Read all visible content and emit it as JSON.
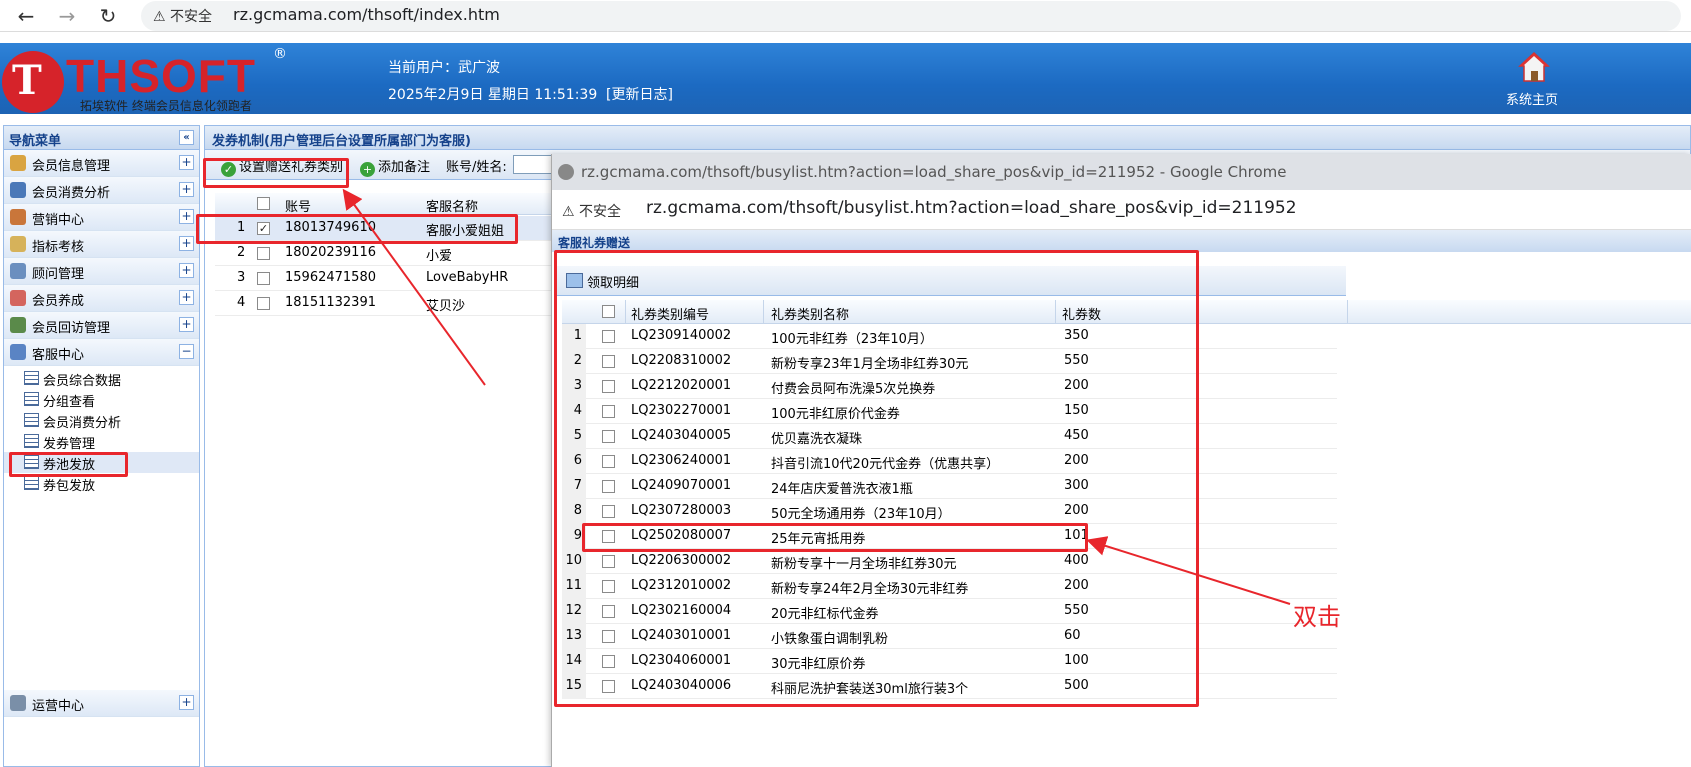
{
  "browser": {
    "back": "←",
    "forward": "→",
    "reload": "↻",
    "insecure_label": "⚠ 不安全",
    "url": "rz.gcmama.com/thsoft/index.htm"
  },
  "header": {
    "logo_text": "THSOFT",
    "logo_mark": "T",
    "logo_reg": "®",
    "logo_sub": "拓埃软件  终端会员信息化领跑者",
    "current_user": "当前用户：武广波",
    "datetime": "2025年2月9日 星期日 11:51:39",
    "changelog": "[更新日志]",
    "home_label": "系统主页"
  },
  "sidebar": {
    "title": "导航菜单",
    "collapse": "«",
    "items": [
      {
        "label": "会员信息管理",
        "toggle": "+",
        "color": "#d9a441"
      },
      {
        "label": "会员消费分析",
        "toggle": "+",
        "color": "#4a78b8"
      },
      {
        "label": "营销中心",
        "toggle": "+",
        "color": "#c9763a"
      },
      {
        "label": "指标考核",
        "toggle": "+",
        "color": "#d6b25a"
      },
      {
        "label": "顾问管理",
        "toggle": "+",
        "color": "#6b8fbf"
      },
      {
        "label": "会员养成",
        "toggle": "+",
        "color": "#d4655e"
      },
      {
        "label": "会员回访管理",
        "toggle": "+",
        "color": "#5a8a4a"
      },
      {
        "label": "客服中心",
        "toggle": "−",
        "color": "#5a84c4"
      }
    ],
    "sub_items": [
      "会员综合数据",
      "分组查看",
      "会员消费分析",
      "发券管理",
      "券池发放",
      "券包发放"
    ],
    "bottom_item": {
      "label": "运营中心",
      "toggle": "+"
    }
  },
  "main": {
    "title": "发券机制(用户管理后台设置所属部门为客服)",
    "toolbar": {
      "set_btn": "设置赠送礼券类别",
      "add_btn": "添加备注",
      "search_label": "账号/姓名:"
    },
    "columns": [
      "账号",
      "客服名称"
    ],
    "rows": [
      {
        "n": "1",
        "account": "18013749610",
        "name": "客服小爱姐姐",
        "checked": "✓"
      },
      {
        "n": "2",
        "account": "18020239116",
        "name": "小爱",
        "checked": ""
      },
      {
        "n": "3",
        "account": "15962471580",
        "name": "LoveBabyHR",
        "checked": ""
      },
      {
        "n": "4",
        "account": "18151132391",
        "name": "艾贝沙",
        "checked": ""
      }
    ]
  },
  "popup": {
    "window_title": "rz.gcmama.com/thsoft/busylist.htm?action=load_share_pos&vip_id=211952 - Google Chrome",
    "insecure_label": "⚠ 不安全",
    "url": "rz.gcmama.com/thsoft/busylist.htm?action=load_share_pos&vip_id=211952",
    "inner_title": "客服礼券赠送",
    "toolbar_btn": "领取明细",
    "columns": [
      "礼券类别编号",
      "礼券类别名称",
      "礼券数"
    ],
    "rows": [
      {
        "n": "1",
        "code": "LQ2309140002",
        "name": "100元非红券（23年10月）",
        "qty": "350"
      },
      {
        "n": "2",
        "code": "LQ2208310002",
        "name": "新粉专享23年1月全场非红券30元",
        "qty": "550"
      },
      {
        "n": "3",
        "code": "LQ2212020001",
        "name": "付费会员阿布洗澡5次兑换券",
        "qty": "200"
      },
      {
        "n": "4",
        "code": "LQ2302270001",
        "name": "100元非红原价代金券",
        "qty": "150"
      },
      {
        "n": "5",
        "code": "LQ2403040005",
        "name": "优贝嘉洗衣凝珠",
        "qty": "450"
      },
      {
        "n": "6",
        "code": "LQ2306240001",
        "name": "抖音引流10代20元代金券（优惠共享）",
        "qty": "200"
      },
      {
        "n": "7",
        "code": "LQ2409070001",
        "name": "24年店庆爱普洗衣液1瓶",
        "qty": "300"
      },
      {
        "n": "8",
        "code": "LQ2307280003",
        "name": "50元全场通用券（23年10月）",
        "qty": "200"
      },
      {
        "n": "9",
        "code": "LQ2502080007",
        "name": "25年元宵抵用券",
        "qty": "101"
      },
      {
        "n": "10",
        "code": "LQ2206300002",
        "name": "新粉专享十一月全场非红券30元",
        "qty": "400"
      },
      {
        "n": "11",
        "code": "LQ2312010002",
        "name": "新粉专享24年2月全场30元非红券",
        "qty": "200"
      },
      {
        "n": "12",
        "code": "LQ2302160004",
        "name": "20元非红标代金券",
        "qty": "550"
      },
      {
        "n": "13",
        "code": "LQ2403010001",
        "name": "小铁象蛋白调制乳粉",
        "qty": "60"
      },
      {
        "n": "14",
        "code": "LQ2304060001",
        "name": "30元非红原价券",
        "qty": "100"
      },
      {
        "n": "15",
        "code": "LQ2403040006",
        "name": "科丽尼洗护套装送30ml旅行装3个",
        "qty": "500"
      }
    ]
  },
  "annotation": {
    "text": "双击",
    "color": "#e8262c"
  }
}
